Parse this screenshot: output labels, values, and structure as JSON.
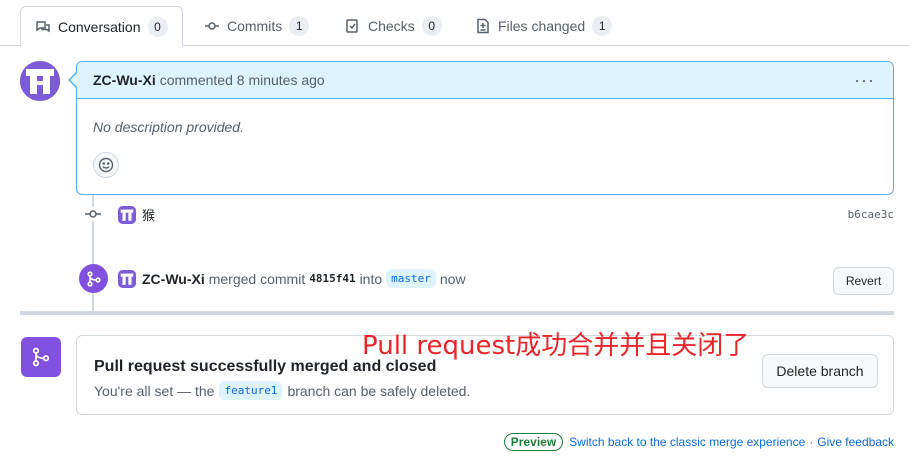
{
  "tabs": [
    {
      "label": "Conversation",
      "count": "0",
      "icon": "conversation-icon"
    },
    {
      "label": "Commits",
      "count": "1",
      "icon": "commit-icon"
    },
    {
      "label": "Checks",
      "count": "0",
      "icon": "checks-icon"
    },
    {
      "label": "Files changed",
      "count": "1",
      "icon": "file-diff-icon"
    }
  ],
  "comment": {
    "author": "ZC-Wu-Xi",
    "action": "commented 8 minutes ago",
    "body": "No description provided."
  },
  "commit": {
    "message": "猴",
    "sha": "b6cae3c"
  },
  "merge_event": {
    "author": "ZC-Wu-Xi",
    "text_merged": "merged commit",
    "sha": "4815f41",
    "text_into": "into",
    "branch": "master",
    "time": "now",
    "revert_label": "Revert"
  },
  "merged_box": {
    "title": "Pull request successfully merged and closed",
    "sub_prefix": "You're all set — the",
    "branch": "feature1",
    "sub_suffix": "branch can be safely deleted.",
    "delete_label": "Delete branch"
  },
  "annotation": "Pull request成功合并并且关闭了",
  "footer": {
    "preview": "Preview",
    "switch_link": "Switch back to the classic merge experience",
    "separator": "·",
    "feedback_link": "Give feedback"
  },
  "colors": {
    "accent_purple": "#8250df",
    "link_blue": "#0969da",
    "annotation_red": "#e8262a",
    "preview_green": "#1a7f37"
  }
}
